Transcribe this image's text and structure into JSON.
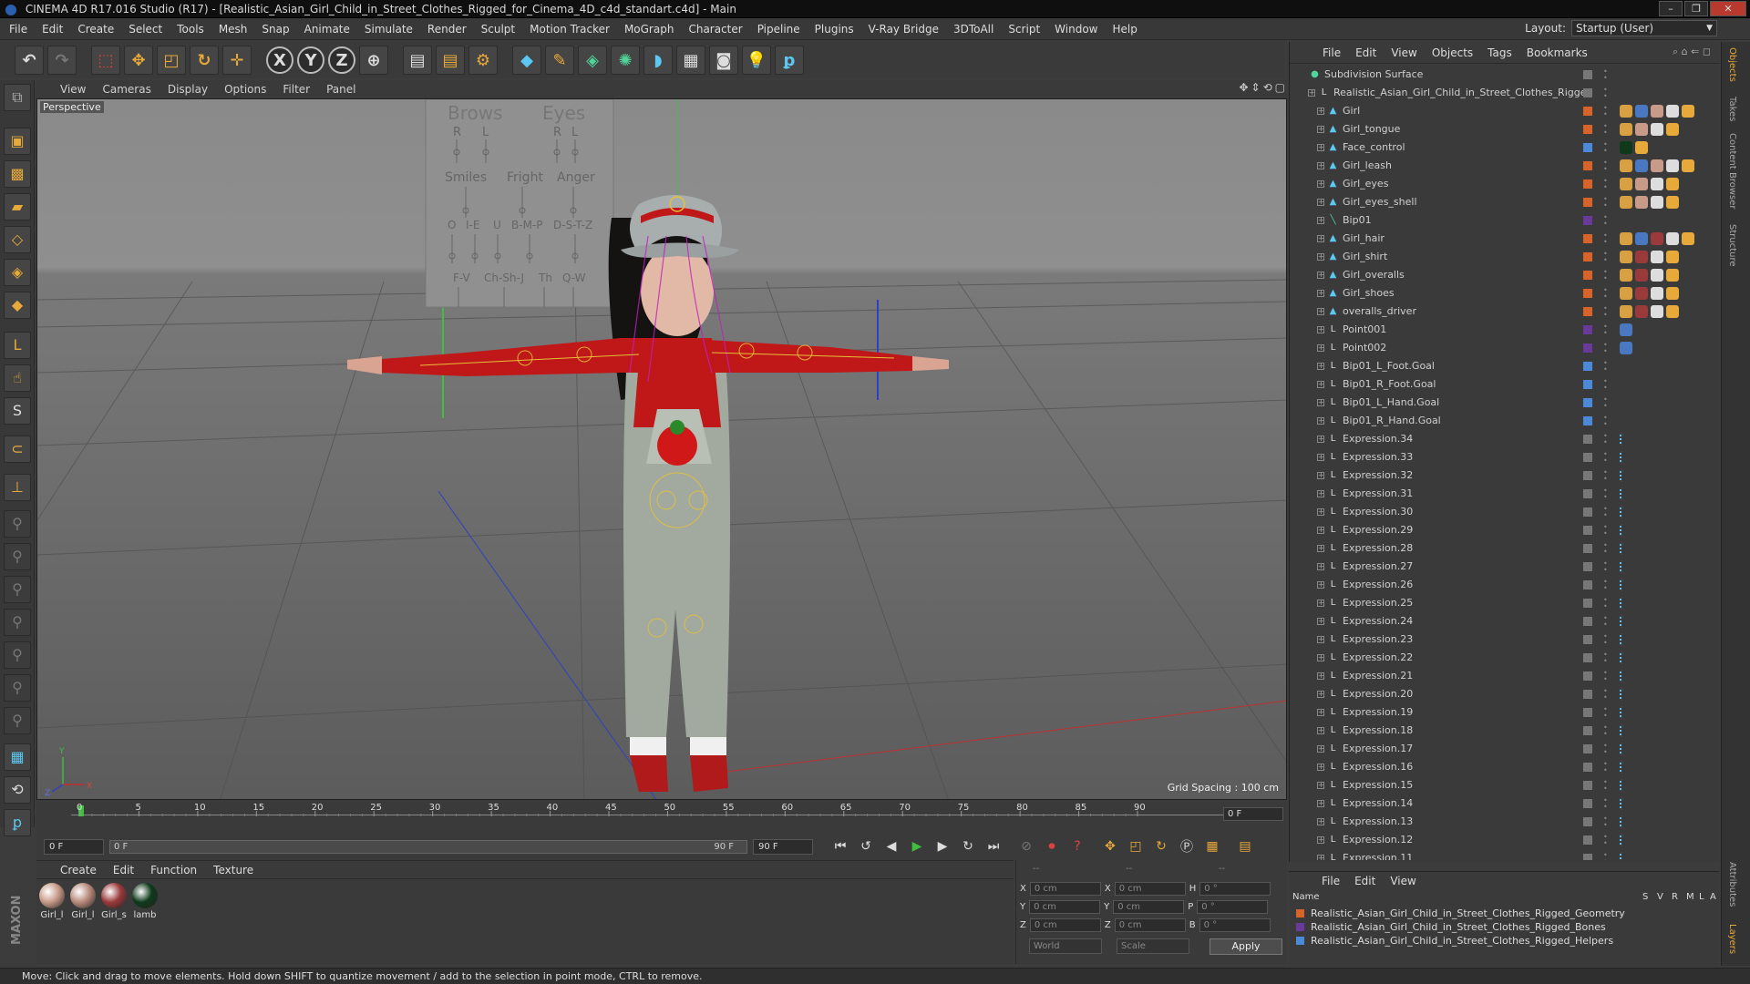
{
  "window": {
    "title": "CINEMA 4D R17.016 Studio (R17) - [Realistic_Asian_Girl_Child_in_Street_Clothes_Rigged_for_Cinema_4D_c4d_standart.c4d] - Main",
    "controls": {
      "minimize": "–",
      "maximize": "❐",
      "close": "✕"
    }
  },
  "menu": [
    "File",
    "Edit",
    "Create",
    "Select",
    "Tools",
    "Mesh",
    "Snap",
    "Animate",
    "Simulate",
    "Render",
    "Sculpt",
    "Motion Tracker",
    "MoGraph",
    "Character",
    "Pipeline",
    "Plugins",
    "V-Ray Bridge",
    "3DToAll",
    "Script",
    "Window",
    "Help"
  ],
  "layout": {
    "label": "Layout:",
    "value": "Startup (User)"
  },
  "toolbar": {
    "icons": [
      "undo-icon",
      "redo-icon",
      "live-selection-icon",
      "move-icon",
      "scale-icon",
      "rotate-icon",
      "place-icon",
      "x-axis-icon",
      "y-axis-icon",
      "z-axis-icon",
      "coordinate-system-icon",
      "render-view-icon",
      "render-picture-viewer-icon",
      "render-settings-icon",
      "cube-icon",
      "spline-pen-icon",
      "subdivision-icon",
      "array-icon",
      "deformer-icon",
      "floor-icon",
      "camera-icon",
      "light-icon",
      "python-icon"
    ],
    "axis_labels": {
      "x": "X",
      "y": "Y",
      "z": "Z"
    }
  },
  "viewport": {
    "menu": [
      "View",
      "Cameras",
      "Display",
      "Options",
      "Filter",
      "Panel"
    ],
    "camera_label": "Perspective",
    "grid_spacing": "Grid Spacing : 100 cm",
    "face_control": {
      "brows": "Brows",
      "eyes": "Eyes",
      "r": "R",
      "l": "L",
      "smiles": "Smiles",
      "fright": "Fright",
      "anger": "Anger",
      "o": "O",
      "ie": "I-E",
      "u": "U",
      "bmp": "B-M-P",
      "dstz": "D-S-T-Z",
      "fv": "F-V",
      "chshj": "Ch-Sh-J",
      "th": "Th",
      "qw": "Q-W"
    },
    "axis": {
      "y": "Y",
      "z": "Z",
      "x": "X"
    }
  },
  "timeline": {
    "ticks": [
      "0",
      "5",
      "10",
      "15",
      "20",
      "25",
      "30",
      "35",
      "40",
      "45",
      "50",
      "55",
      "60",
      "65",
      "70",
      "75",
      "80",
      "85",
      "90"
    ],
    "current_frame": "0 F"
  },
  "transport": {
    "start": "0 F",
    "slider_start": "0 F",
    "slider_end": "90 F",
    "end": "90 F"
  },
  "materials": {
    "menu": [
      "Create",
      "Edit",
      "Function",
      "Texture"
    ],
    "items": [
      {
        "label": "Girl_l",
        "color": "#c89a88"
      },
      {
        "label": "Girl_l",
        "color": "#b88a7a"
      },
      {
        "label": "Girl_s",
        "color": "#9a3a3a"
      },
      {
        "label": "lamb",
        "color": "#0f3a1a"
      }
    ]
  },
  "coords": {
    "header": [
      "--",
      "--",
      "--"
    ],
    "rows": [
      {
        "a": "X",
        "av": "0 cm",
        "b": "X",
        "bv": "0 cm",
        "c": "H",
        "cv": "0 °"
      },
      {
        "a": "Y",
        "av": "0 cm",
        "b": "Y",
        "bv": "0 cm",
        "c": "P",
        "cv": "0 °"
      },
      {
        "a": "Z",
        "av": "0 cm",
        "b": "Z",
        "bv": "0 cm",
        "c": "B",
        "cv": "0 °"
      }
    ],
    "space": "World",
    "mode": "Scale",
    "apply": "Apply"
  },
  "objects": {
    "menu": [
      "File",
      "Edit",
      "View",
      "Objects",
      "Tags",
      "Bookmarks"
    ],
    "rows": [
      {
        "name": "Subdivision Surface",
        "indent": 0,
        "icon": "●",
        "iconColor": "#4fd49a",
        "tag": "#777",
        "kind": "subdiv",
        "tags": []
      },
      {
        "name": "Realistic_Asian_Girl_Child_in_Street_Clothes_Rigged",
        "indent": 1,
        "icon": "L",
        "iconColor": "#ddd",
        "tag": "#777",
        "kind": "null",
        "tags": []
      },
      {
        "name": "Girl",
        "indent": 2,
        "icon": "▲",
        "iconColor": "#5cc8f2",
        "tag": "#d8642a",
        "tags": [
          "#d8a040",
          "#4a78c0",
          "#c89a88",
          "#ddd",
          "#e6a93a"
        ]
      },
      {
        "name": "Girl_tongue",
        "indent": 2,
        "icon": "▲",
        "iconColor": "#5cc8f2",
        "tag": "#d8642a",
        "tags": [
          "#d8a040",
          "#c89a88",
          "#ddd",
          "#e6a93a"
        ]
      },
      {
        "name": "Face_control",
        "indent": 2,
        "icon": "▲",
        "iconColor": "#5cc8f2",
        "tag": "#4a8ad8",
        "tags": [
          "#0f3a1a",
          "#e6a93a"
        ]
      },
      {
        "name": "Girl_leash",
        "indent": 2,
        "icon": "▲",
        "iconColor": "#5cc8f2",
        "tag": "#d8642a",
        "tags": [
          "#d8a040",
          "#4a78c0",
          "#c89a88",
          "#ddd",
          "#e6a93a"
        ]
      },
      {
        "name": "Girl_eyes",
        "indent": 2,
        "icon": "▲",
        "iconColor": "#5cc8f2",
        "tag": "#d8642a",
        "tags": [
          "#d8a040",
          "#c89a88",
          "#ddd",
          "#e6a93a"
        ]
      },
      {
        "name": "Girl_eyes_shell",
        "indent": 2,
        "icon": "▲",
        "iconColor": "#5cc8f2",
        "tag": "#d8642a",
        "tags": [
          "#d8a040",
          "#c89a88",
          "#ddd",
          "#e6a93a"
        ]
      },
      {
        "name": "Bip01",
        "indent": 2,
        "icon": "╲",
        "iconColor": "#4fd49a",
        "tag": "#6a3a9a",
        "tags": []
      },
      {
        "name": "Girl_hair",
        "indent": 2,
        "icon": "▲",
        "iconColor": "#5cc8f2",
        "tag": "#d8642a",
        "tags": [
          "#d8a040",
          "#4a78c0",
          "#9a3a3a",
          "#ddd",
          "#e6a93a"
        ]
      },
      {
        "name": "Girl_shirt",
        "indent": 2,
        "icon": "▲",
        "iconColor": "#5cc8f2",
        "tag": "#d8642a",
        "tags": [
          "#d8a040",
          "#9a3a3a",
          "#ddd",
          "#e6a93a"
        ]
      },
      {
        "name": "Girl_overalls",
        "indent": 2,
        "icon": "▲",
        "iconColor": "#5cc8f2",
        "tag": "#d8642a",
        "tags": [
          "#d8a040",
          "#9a3a3a",
          "#ddd",
          "#e6a93a"
        ]
      },
      {
        "name": "Girl_shoes",
        "indent": 2,
        "icon": "▲",
        "iconColor": "#5cc8f2",
        "tag": "#d8642a",
        "tags": [
          "#d8a040",
          "#9a3a3a",
          "#ddd",
          "#e6a93a"
        ]
      },
      {
        "name": "overalls_driver",
        "indent": 2,
        "icon": "▲",
        "iconColor": "#5cc8f2",
        "tag": "#d8642a",
        "tags": [
          "#d8a040",
          "#9a3a3a",
          "#ddd",
          "#e6a93a"
        ]
      },
      {
        "name": "Point001",
        "indent": 2,
        "icon": "L",
        "iconColor": "#ddd",
        "tag": "#6a3a9a",
        "tags": [
          "#4a78c0"
        ]
      },
      {
        "name": "Point002",
        "indent": 2,
        "icon": "L",
        "iconColor": "#ddd",
        "tag": "#6a3a9a",
        "tags": [
          "#4a78c0"
        ]
      },
      {
        "name": "Bip01_L_Foot.Goal",
        "indent": 2,
        "icon": "L",
        "iconColor": "#ddd",
        "tag": "#4a8ad8",
        "tags": []
      },
      {
        "name": "Bip01_R_Foot.Goal",
        "indent": 2,
        "icon": "L",
        "iconColor": "#ddd",
        "tag": "#4a8ad8",
        "tags": []
      },
      {
        "name": "Bip01_L_Hand.Goal",
        "indent": 2,
        "icon": "L",
        "iconColor": "#ddd",
        "tag": "#4a8ad8",
        "tags": []
      },
      {
        "name": "Bip01_R_Hand.Goal",
        "indent": 2,
        "icon": "L",
        "iconColor": "#ddd",
        "tag": "#4a8ad8",
        "tags": []
      },
      {
        "name": "Expression.34",
        "indent": 2,
        "icon": "L",
        "iconColor": "#ddd",
        "tag": "#777",
        "tags": [
          "expr"
        ]
      },
      {
        "name": "Expression.33",
        "indent": 2,
        "icon": "L",
        "iconColor": "#ddd",
        "tag": "#777",
        "tags": [
          "expr"
        ]
      },
      {
        "name": "Expression.32",
        "indent": 2,
        "icon": "L",
        "iconColor": "#ddd",
        "tag": "#777",
        "tags": [
          "expr"
        ]
      },
      {
        "name": "Expression.31",
        "indent": 2,
        "icon": "L",
        "iconColor": "#ddd",
        "tag": "#777",
        "tags": [
          "expr"
        ]
      },
      {
        "name": "Expression.30",
        "indent": 2,
        "icon": "L",
        "iconColor": "#ddd",
        "tag": "#777",
        "tags": [
          "expr"
        ]
      },
      {
        "name": "Expression.29",
        "indent": 2,
        "icon": "L",
        "iconColor": "#ddd",
        "tag": "#777",
        "tags": [
          "expr"
        ]
      },
      {
        "name": "Expression.28",
        "indent": 2,
        "icon": "L",
        "iconColor": "#ddd",
        "tag": "#777",
        "tags": [
          "expr"
        ]
      },
      {
        "name": "Expression.27",
        "indent": 2,
        "icon": "L",
        "iconColor": "#ddd",
        "tag": "#777",
        "tags": [
          "expr"
        ]
      },
      {
        "name": "Expression.26",
        "indent": 2,
        "icon": "L",
        "iconColor": "#ddd",
        "tag": "#777",
        "tags": [
          "expr"
        ]
      },
      {
        "name": "Expression.25",
        "indent": 2,
        "icon": "L",
        "iconColor": "#ddd",
        "tag": "#777",
        "tags": [
          "expr"
        ]
      },
      {
        "name": "Expression.24",
        "indent": 2,
        "icon": "L",
        "iconColor": "#ddd",
        "tag": "#777",
        "tags": [
          "expr"
        ]
      },
      {
        "name": "Expression.23",
        "indent": 2,
        "icon": "L",
        "iconColor": "#ddd",
        "tag": "#777",
        "tags": [
          "expr"
        ]
      },
      {
        "name": "Expression.22",
        "indent": 2,
        "icon": "L",
        "iconColor": "#ddd",
        "tag": "#777",
        "tags": [
          "expr"
        ]
      },
      {
        "name": "Expression.21",
        "indent": 2,
        "icon": "L",
        "iconColor": "#ddd",
        "tag": "#777",
        "tags": [
          "expr"
        ]
      },
      {
        "name": "Expression.20",
        "indent": 2,
        "icon": "L",
        "iconColor": "#ddd",
        "tag": "#777",
        "tags": [
          "expr"
        ]
      },
      {
        "name": "Expression.19",
        "indent": 2,
        "icon": "L",
        "iconColor": "#ddd",
        "tag": "#777",
        "tags": [
          "expr"
        ]
      },
      {
        "name": "Expression.18",
        "indent": 2,
        "icon": "L",
        "iconColor": "#ddd",
        "tag": "#777",
        "tags": [
          "expr"
        ]
      },
      {
        "name": "Expression.17",
        "indent": 2,
        "icon": "L",
        "iconColor": "#ddd",
        "tag": "#777",
        "tags": [
          "expr"
        ]
      },
      {
        "name": "Expression.16",
        "indent": 2,
        "icon": "L",
        "iconColor": "#ddd",
        "tag": "#777",
        "tags": [
          "expr"
        ]
      },
      {
        "name": "Expression.15",
        "indent": 2,
        "icon": "L",
        "iconColor": "#ddd",
        "tag": "#777",
        "tags": [
          "expr"
        ]
      },
      {
        "name": "Expression.14",
        "indent": 2,
        "icon": "L",
        "iconColor": "#ddd",
        "tag": "#777",
        "tags": [
          "expr"
        ]
      },
      {
        "name": "Expression.13",
        "indent": 2,
        "icon": "L",
        "iconColor": "#ddd",
        "tag": "#777",
        "tags": [
          "expr"
        ]
      },
      {
        "name": "Expression.12",
        "indent": 2,
        "icon": "L",
        "iconColor": "#ddd",
        "tag": "#777",
        "tags": [
          "expr"
        ]
      },
      {
        "name": "Expression.11",
        "indent": 2,
        "icon": "L",
        "iconColor": "#ddd",
        "tag": "#777",
        "tags": [
          "expr"
        ]
      }
    ]
  },
  "layers": {
    "menu": [
      "File",
      "Edit",
      "View"
    ],
    "header": {
      "name": "Name",
      "cols": [
        "S",
        "V",
        "R",
        "M",
        "L",
        "A"
      ]
    },
    "rows": [
      {
        "name": "Realistic_Asian_Girl_Child_in_Street_Clothes_Rigged_Geometry",
        "color": "#d8642a"
      },
      {
        "name": "Realistic_Asian_Girl_Child_in_Street_Clothes_Rigged_Bones",
        "color": "#6a3a9a"
      },
      {
        "name": "Realistic_Asian_Girl_Child_in_Street_Clothes_Rigged_Helpers",
        "color": "#4a8ad8"
      }
    ]
  },
  "side_tabs": [
    "Objects",
    "Takes",
    "Content Browser",
    "Structure",
    "Attributes",
    "Layers"
  ],
  "status": "Move: Click and drag to move elements. Hold down SHIFT to quantize movement / add to the selection in point mode, CTRL to remove.",
  "logo": "MAXON CINEMA 4D"
}
